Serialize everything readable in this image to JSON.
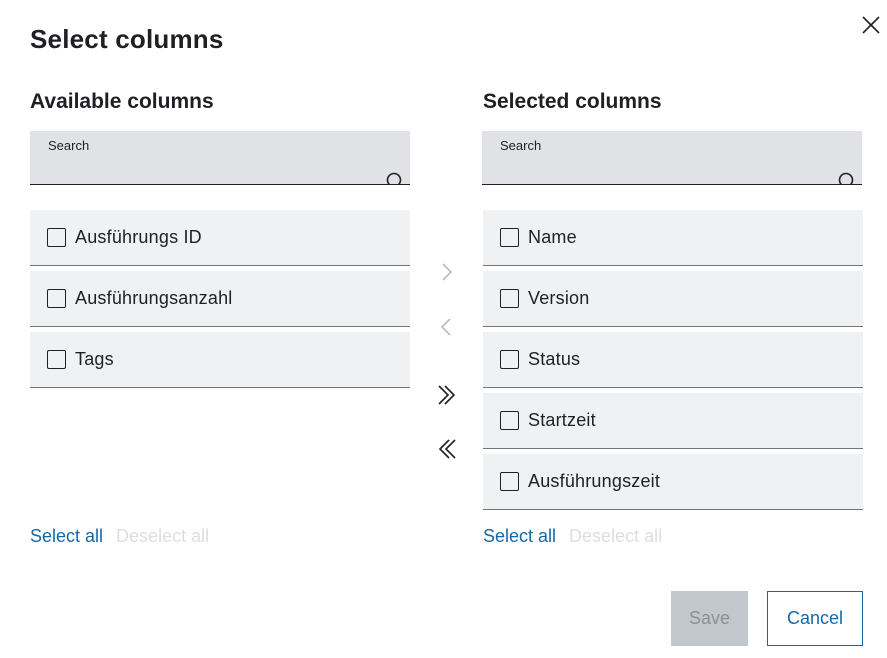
{
  "dialog": {
    "title": "Select columns",
    "close_icon": "close-icon"
  },
  "available": {
    "heading": "Available columns",
    "search_label": "Search",
    "search_value": "",
    "items": [
      {
        "label": "Ausführungs ID",
        "checked": false
      },
      {
        "label": "Ausführungsanzahl",
        "checked": false
      },
      {
        "label": "Tags",
        "checked": false
      }
    ],
    "select_all": "Select all",
    "deselect_all": "Deselect all"
  },
  "selected": {
    "heading": "Selected columns",
    "search_label": "Search",
    "search_value": "",
    "items": [
      {
        "label": "Name",
        "checked": false
      },
      {
        "label": "Version",
        "checked": false
      },
      {
        "label": "Status",
        "checked": false
      },
      {
        "label": "Startzeit",
        "checked": false
      },
      {
        "label": "Ausführungszeit",
        "checked": false
      }
    ],
    "select_all": "Select all",
    "deselect_all": "Deselect all"
  },
  "transfer": {
    "move_right_icon": "chevron-right-icon",
    "move_left_icon": "chevron-left-icon",
    "move_all_right_icon": "double-chevron-right-icon",
    "move_all_left_icon": "double-chevron-left-icon"
  },
  "footer": {
    "save_label": "Save",
    "cancel_label": "Cancel"
  },
  "colors": {
    "accent": "#1469a8",
    "disabled_text": "#dcdee0",
    "item_background": "#eff1f2",
    "search_background": "#e0e2e5",
    "save_disabled_background": "#c1c7cc"
  }
}
